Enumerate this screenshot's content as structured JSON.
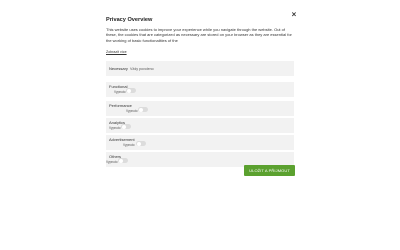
{
  "modal": {
    "title": "Privacy Overview",
    "close_icon": "×",
    "description": "This website uses cookies to improve your experience while you navigate through the website. Out of these, the cookies that are categorized as necessary are stored on your browser as they are essential for the working of basic functionalities of the",
    "show_more": "Zobrazit více",
    "sections": [
      {
        "label": "Necessary",
        "status": "Vždy povoleno"
      },
      {
        "label": "Functional",
        "status": "Vypnuto"
      },
      {
        "label": "Performance",
        "status": "Vypnuto"
      },
      {
        "label": "Analytics",
        "status": "Vypnuto"
      },
      {
        "label": "Advertisement",
        "status": "Vypnuto"
      },
      {
        "label": "Others",
        "status": "Vypnuto"
      }
    ],
    "save_button": "ULOŽIT A PŘIJMOUT"
  },
  "colors": {
    "accent": "#5ba12f",
    "section_bg": "#f2f2f2",
    "toggle_off": "#dcdcdc"
  }
}
